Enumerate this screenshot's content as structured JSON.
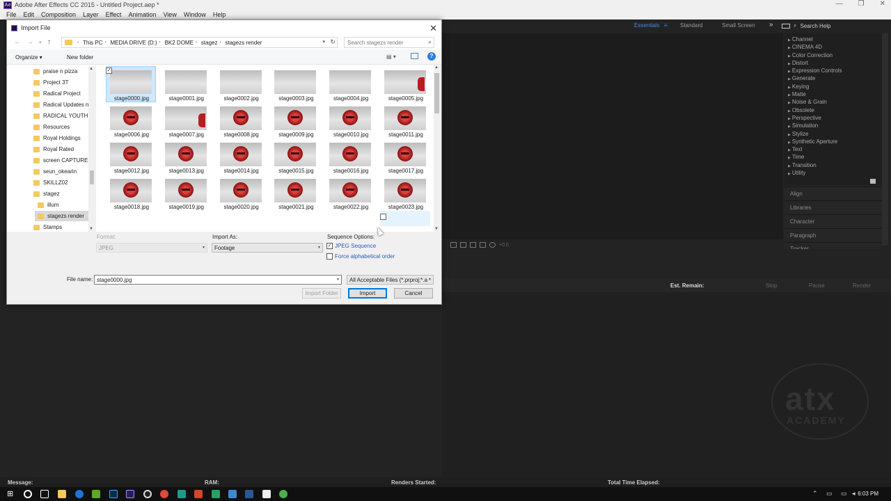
{
  "app": {
    "title": "Adobe After Effects CC 2015 - Untitled Project.aep *",
    "logo": "Ae",
    "menu": [
      "File",
      "Edit",
      "Composition",
      "Layer",
      "Effect",
      "Animation",
      "View",
      "Window",
      "Help"
    ]
  },
  "workspaces": {
    "items": [
      "Essentials",
      "Standard",
      "Small Screen"
    ],
    "more": "»",
    "search_help": "Search Help"
  },
  "effects": [
    "Channel",
    "CINEMA 4D",
    "Color Correction",
    "Distort",
    "Expression Controls",
    "Generate",
    "Keying",
    "Matte",
    "Noise & Grain",
    "Obsolete",
    "Perspective",
    "Simulation",
    "Stylize",
    "Synthetic Aperture",
    "Text",
    "Time",
    "Transition",
    "Utility"
  ],
  "panels": [
    "Align",
    "Libraries",
    "Character",
    "Paragraph",
    "Tracker"
  ],
  "mini_toolbar_value": "+0.0",
  "render_queue": {
    "est_remain": "Est. Remain:",
    "stop": "Stop",
    "pause": "Pause",
    "render": "Render"
  },
  "watermark": {
    "big": "atx",
    "small": "ACADEMY"
  },
  "status": {
    "message": "Message:",
    "ram": "RAM:",
    "renders_started": "Renders Started:",
    "total_time": "Total Time Elapsed:"
  },
  "taskbar": {
    "time": "6:03 PM"
  },
  "dialog": {
    "title": "Import File",
    "close": "✕",
    "breadcrumbs": [
      "This PC",
      "MEDIA DRIVE (D:)",
      "BK2 DOME",
      "stagez",
      "stagezs render"
    ],
    "search_placeholder": "Search stagezs render",
    "organize": "Organize ▾",
    "new_folder": "New folder",
    "help": "?",
    "nav_items": [
      "praise n pizza",
      "Project 3T",
      "Radical Project",
      "Radical Updates n",
      "RADICAL YOUTH V",
      "Resources",
      "Royal Holdings",
      "Royal Rated",
      "screen CAPTURE",
      "seun_okearin",
      "SKILLZ02",
      "stagez",
      "illum",
      "stagezs render",
      "Stamps"
    ],
    "files": [
      "stage0000.jpg",
      "stage0001.jpg",
      "stage0002.jpg",
      "stage0003.jpg",
      "stage0004.jpg",
      "stage0005.jpg",
      "stage0006.jpg",
      "stage0007.jpg",
      "stage0008.jpg",
      "stage0009.jpg",
      "stage0010.jpg",
      "stage0011.jpg",
      "stage0012.jpg",
      "stage0013.jpg",
      "stage0014.jpg",
      "stage0015.jpg",
      "stage0016.jpg",
      "stage0017.jpg",
      "stage0018.jpg",
      "stage0019.jpg",
      "stage0020.jpg",
      "stage0021.jpg",
      "stage0022.jpg",
      "stage0023.jpg"
    ],
    "format_label": "Format:",
    "format_value": "JPEG",
    "import_as_label": "Import As:",
    "import_as_value": "Footage",
    "sequence_options_label": "Sequence Options:",
    "jpeg_sequence": "JPEG Sequence",
    "force_alpha": "Force alphabetical order",
    "file_name_label": "File name:",
    "file_name_value": "stage0000.jpg",
    "file_type_value": "All Acceptable Files (*.prproj;*.a",
    "import_folder": "Import Folder",
    "import": "Import",
    "cancel": "Cancel"
  }
}
